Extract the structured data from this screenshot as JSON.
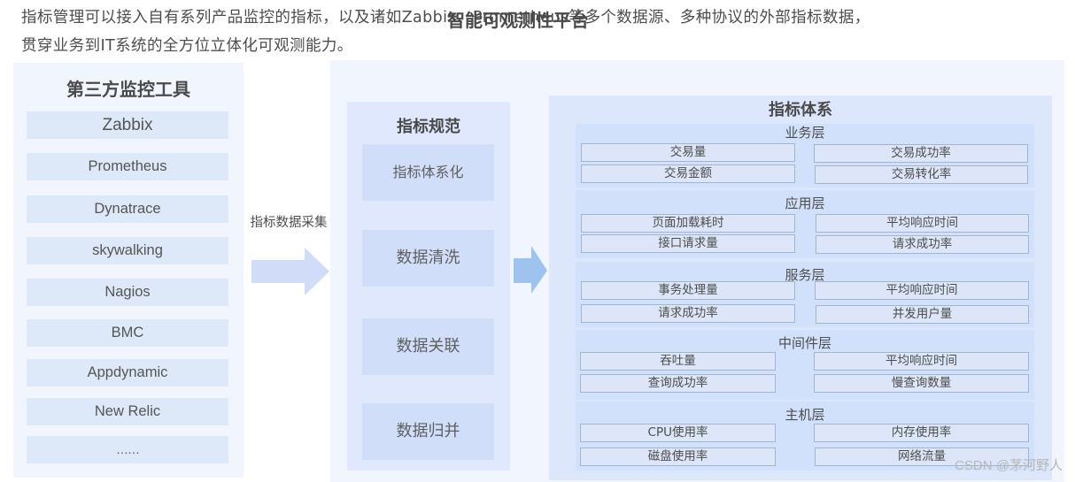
{
  "intro": {
    "line1": "指标管理可以接入自有系列产品监控的指标，以及诸如Zabbix、Prometheus等多个数据源、多种协议的外部指标数据，",
    "line2": "贯穿业务到IT系统的全方位立体化可观测能力。"
  },
  "third_party": {
    "title": "第三方监控工具",
    "tools": [
      "Zabbix",
      "Prometheus",
      "Dynatrace",
      "skywalking",
      "Nagios",
      "BMC",
      "Appdynamic",
      "New Relic",
      "……"
    ]
  },
  "collection": {
    "label": "指标数据采集",
    "arrow_icon": "right-arrow",
    "arrow_color_1": "#d0dcf8",
    "arrow_color_2": "#9fc3ef"
  },
  "platform": {
    "title": "智能可观测性平台",
    "spec": {
      "title": "指标规范",
      "items": [
        "指标体系化",
        "数据清洗",
        "数据关联",
        "数据归并"
      ]
    },
    "system": {
      "title": "指标体系",
      "layers": [
        {
          "name": "业务层",
          "metrics": [
            "交易量",
            "交易成功率",
            "交易金额",
            "交易转化率"
          ]
        },
        {
          "name": "应用层",
          "metrics": [
            "页面加载耗时",
            "平均响应时间",
            "接口请求量",
            "请求成功率"
          ]
        },
        {
          "name": "服务层",
          "metrics": [
            "事务处理量",
            "平均响应时间",
            "请求成功率",
            "并发用户量"
          ]
        },
        {
          "name": "中间件层",
          "metrics": [
            "吞吐量",
            "平均响应时间",
            "查询成功率",
            "慢查询数量"
          ]
        },
        {
          "name": "主机层",
          "metrics": [
            "CPU使用率",
            "内存使用率",
            "磁盘使用率",
            "网络流量"
          ]
        }
      ]
    }
  },
  "watermark": "CSDN @茅河野人"
}
